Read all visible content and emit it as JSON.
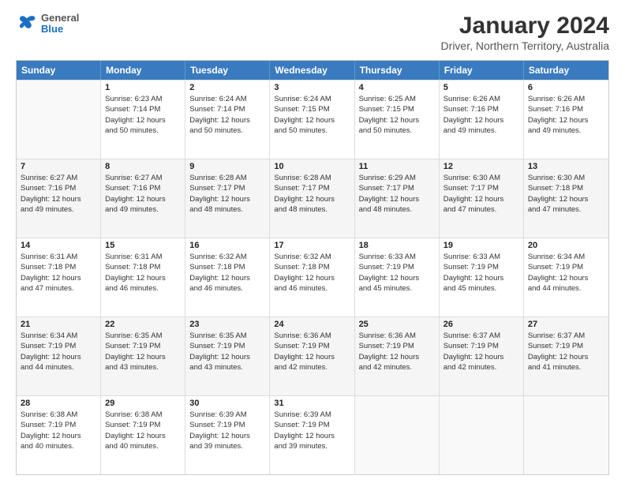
{
  "logo": {
    "general": "General",
    "blue": "Blue"
  },
  "title": "January 2024",
  "subtitle": "Driver, Northern Territory, Australia",
  "days": [
    "Sunday",
    "Monday",
    "Tuesday",
    "Wednesday",
    "Thursday",
    "Friday",
    "Saturday"
  ],
  "weeks": [
    [
      {
        "day": "",
        "empty": true
      },
      {
        "day": "1",
        "lines": [
          "Sunrise: 6:23 AM",
          "Sunset: 7:14 PM",
          "Daylight: 12 hours",
          "and 50 minutes."
        ]
      },
      {
        "day": "2",
        "lines": [
          "Sunrise: 6:24 AM",
          "Sunset: 7:14 PM",
          "Daylight: 12 hours",
          "and 50 minutes."
        ]
      },
      {
        "day": "3",
        "lines": [
          "Sunrise: 6:24 AM",
          "Sunset: 7:15 PM",
          "Daylight: 12 hours",
          "and 50 minutes."
        ]
      },
      {
        "day": "4",
        "lines": [
          "Sunrise: 6:25 AM",
          "Sunset: 7:15 PM",
          "Daylight: 12 hours",
          "and 50 minutes."
        ]
      },
      {
        "day": "5",
        "lines": [
          "Sunrise: 6:26 AM",
          "Sunset: 7:16 PM",
          "Daylight: 12 hours",
          "and 49 minutes."
        ]
      },
      {
        "day": "6",
        "lines": [
          "Sunrise: 6:26 AM",
          "Sunset: 7:16 PM",
          "Daylight: 12 hours",
          "and 49 minutes."
        ]
      }
    ],
    [
      {
        "day": "7",
        "lines": [
          "Sunrise: 6:27 AM",
          "Sunset: 7:16 PM",
          "Daylight: 12 hours",
          "and 49 minutes."
        ]
      },
      {
        "day": "8",
        "lines": [
          "Sunrise: 6:27 AM",
          "Sunset: 7:16 PM",
          "Daylight: 12 hours",
          "and 49 minutes."
        ]
      },
      {
        "day": "9",
        "lines": [
          "Sunrise: 6:28 AM",
          "Sunset: 7:17 PM",
          "Daylight: 12 hours",
          "and 48 minutes."
        ]
      },
      {
        "day": "10",
        "lines": [
          "Sunrise: 6:28 AM",
          "Sunset: 7:17 PM",
          "Daylight: 12 hours",
          "and 48 minutes."
        ]
      },
      {
        "day": "11",
        "lines": [
          "Sunrise: 6:29 AM",
          "Sunset: 7:17 PM",
          "Daylight: 12 hours",
          "and 48 minutes."
        ]
      },
      {
        "day": "12",
        "lines": [
          "Sunrise: 6:30 AM",
          "Sunset: 7:17 PM",
          "Daylight: 12 hours",
          "and 47 minutes."
        ]
      },
      {
        "day": "13",
        "lines": [
          "Sunrise: 6:30 AM",
          "Sunset: 7:18 PM",
          "Daylight: 12 hours",
          "and 47 minutes."
        ]
      }
    ],
    [
      {
        "day": "14",
        "lines": [
          "Sunrise: 6:31 AM",
          "Sunset: 7:18 PM",
          "Daylight: 12 hours",
          "and 47 minutes."
        ]
      },
      {
        "day": "15",
        "lines": [
          "Sunrise: 6:31 AM",
          "Sunset: 7:18 PM",
          "Daylight: 12 hours",
          "and 46 minutes."
        ]
      },
      {
        "day": "16",
        "lines": [
          "Sunrise: 6:32 AM",
          "Sunset: 7:18 PM",
          "Daylight: 12 hours",
          "and 46 minutes."
        ]
      },
      {
        "day": "17",
        "lines": [
          "Sunrise: 6:32 AM",
          "Sunset: 7:18 PM",
          "Daylight: 12 hours",
          "and 46 minutes."
        ]
      },
      {
        "day": "18",
        "lines": [
          "Sunrise: 6:33 AM",
          "Sunset: 7:19 PM",
          "Daylight: 12 hours",
          "and 45 minutes."
        ]
      },
      {
        "day": "19",
        "lines": [
          "Sunrise: 6:33 AM",
          "Sunset: 7:19 PM",
          "Daylight: 12 hours",
          "and 45 minutes."
        ]
      },
      {
        "day": "20",
        "lines": [
          "Sunrise: 6:34 AM",
          "Sunset: 7:19 PM",
          "Daylight: 12 hours",
          "and 44 minutes."
        ]
      }
    ],
    [
      {
        "day": "21",
        "lines": [
          "Sunrise: 6:34 AM",
          "Sunset: 7:19 PM",
          "Daylight: 12 hours",
          "and 44 minutes."
        ]
      },
      {
        "day": "22",
        "lines": [
          "Sunrise: 6:35 AM",
          "Sunset: 7:19 PM",
          "Daylight: 12 hours",
          "and 43 minutes."
        ]
      },
      {
        "day": "23",
        "lines": [
          "Sunrise: 6:35 AM",
          "Sunset: 7:19 PM",
          "Daylight: 12 hours",
          "and 43 minutes."
        ]
      },
      {
        "day": "24",
        "lines": [
          "Sunrise: 6:36 AM",
          "Sunset: 7:19 PM",
          "Daylight: 12 hours",
          "and 42 minutes."
        ]
      },
      {
        "day": "25",
        "lines": [
          "Sunrise: 6:36 AM",
          "Sunset: 7:19 PM",
          "Daylight: 12 hours",
          "and 42 minutes."
        ]
      },
      {
        "day": "26",
        "lines": [
          "Sunrise: 6:37 AM",
          "Sunset: 7:19 PM",
          "Daylight: 12 hours",
          "and 42 minutes."
        ]
      },
      {
        "day": "27",
        "lines": [
          "Sunrise: 6:37 AM",
          "Sunset: 7:19 PM",
          "Daylight: 12 hours",
          "and 41 minutes."
        ]
      }
    ],
    [
      {
        "day": "28",
        "lines": [
          "Sunrise: 6:38 AM",
          "Sunset: 7:19 PM",
          "Daylight: 12 hours",
          "and 40 minutes."
        ]
      },
      {
        "day": "29",
        "lines": [
          "Sunrise: 6:38 AM",
          "Sunset: 7:19 PM",
          "Daylight: 12 hours",
          "and 40 minutes."
        ]
      },
      {
        "day": "30",
        "lines": [
          "Sunrise: 6:39 AM",
          "Sunset: 7:19 PM",
          "Daylight: 12 hours",
          "and 39 minutes."
        ]
      },
      {
        "day": "31",
        "lines": [
          "Sunrise: 6:39 AM",
          "Sunset: 7:19 PM",
          "Daylight: 12 hours",
          "and 39 minutes."
        ]
      },
      {
        "day": "",
        "empty": true
      },
      {
        "day": "",
        "empty": true
      },
      {
        "day": "",
        "empty": true
      }
    ]
  ]
}
